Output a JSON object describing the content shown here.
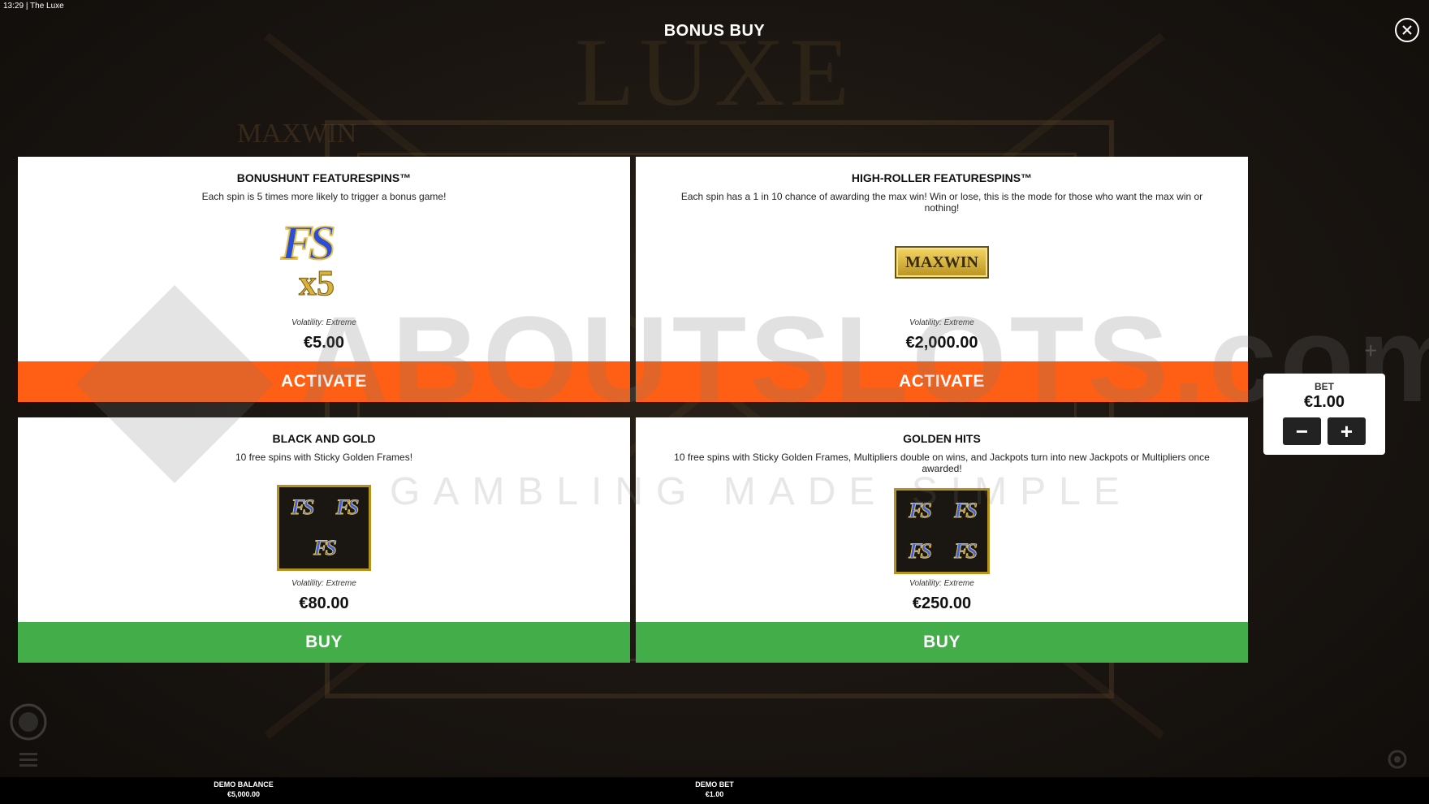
{
  "status": {
    "time": "13:29",
    "separator": "|",
    "game_name": "The Luxe"
  },
  "background": {
    "logo_text": "LUXE",
    "maxwin_text": "MAXWIN"
  },
  "header": {
    "title": "BONUS BUY",
    "close_icon": "close-circle-icon"
  },
  "cards": [
    {
      "title": "BONUSHUNT FEATURESPINS™",
      "description": "Each spin is 5 times more likely to trigger a bonus game!",
      "image_text_main": "FS",
      "image_text_sub": "x5",
      "volatility_label": "Volatility:",
      "volatility_value": "Extreme",
      "price": "€5.00",
      "action": "ACTIVATE"
    },
    {
      "title": "HIGH-ROLLER FEATURESPINS™",
      "description": "Each spin has a 1 in 10 chance of awarding the max win! Win or lose, this is the mode for those who want the max win or nothing!",
      "image_text_main": "MAXWIN",
      "volatility_label": "Volatility:",
      "volatility_value": "Extreme",
      "price": "€2,000.00",
      "action": "ACTIVATE"
    },
    {
      "title": "BLACK AND GOLD",
      "description": "10 free spins with Sticky Golden Frames!",
      "image_text_main": "FS",
      "volatility_label": "Volatility:",
      "volatility_value": "Extreme",
      "price": "€80.00",
      "action": "BUY"
    },
    {
      "title": "GOLDEN HITS",
      "description": "10 free spins with Sticky Golden Frames, Multipliers double on wins, and Jackpots turn into new Jackpots or Multipliers once awarded!",
      "image_text_main": "FS",
      "volatility_label": "Volatility:",
      "volatility_value": "Extreme",
      "price": "€250.00",
      "action": "BUY"
    }
  ],
  "bet_panel": {
    "label": "BET",
    "value": "€1.00",
    "minus": "−",
    "plus": "+"
  },
  "watermark": {
    "main": "ABOUTSLOTS.com",
    "sub": "GAMBLING MADE SIMPLE"
  },
  "bottom_bar": {
    "balance_label": "DEMO BALANCE",
    "balance_value": "€5,000.00",
    "bet_label": "DEMO BET",
    "bet_value": "€1.00"
  },
  "colors": {
    "activate": "#ff5f14",
    "buy": "#43ad4a",
    "card_bg": "#ffffff",
    "overlay_bg": "#16120e"
  }
}
